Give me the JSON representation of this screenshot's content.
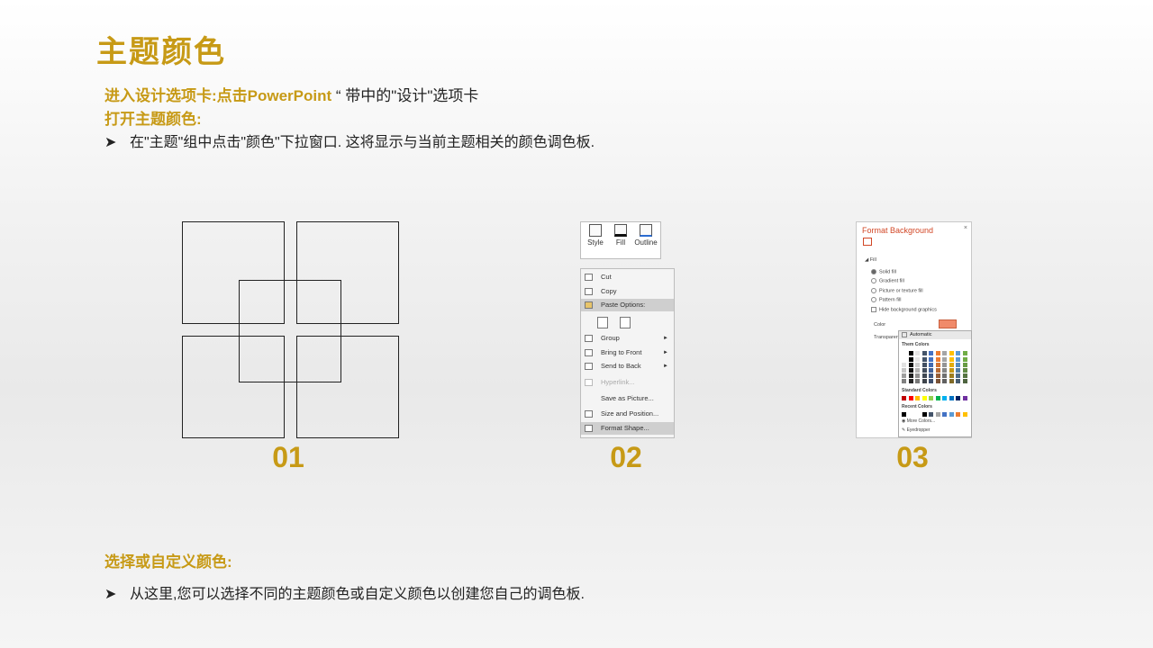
{
  "title": "主题颜色",
  "intro": {
    "line1_bold": "进入设计选项卡:点击PowerPoint",
    "line1_rest": " “ 带中的\"设计\"选项卡",
    "line2": "打开主题颜色:",
    "bullet1": "在\"主题\"组中点击\"颜色\"下拉窗口. 这将显示与当前主题相关的颜色调色板."
  },
  "bullet_char": "➤",
  "steps": [
    "01",
    "02",
    "03"
  ],
  "toolbar": {
    "style": "Style",
    "fill": "Fill",
    "outline": "Outline"
  },
  "context_menu": {
    "items": [
      "Cut",
      "Copy",
      "Paste Options:",
      "Group",
      "Bring to Front",
      "Send to Back",
      "Hyperlink...",
      "Save as Picture...",
      "Size and Position...",
      "Format Shape..."
    ]
  },
  "format_background": {
    "title": "Format Background",
    "close": "×",
    "section": "Fill",
    "options": [
      "Solid fill",
      "Gradient fill",
      "Picture or texture fill",
      "Pattern fill"
    ],
    "hide_bg": "Hide background graphics",
    "color_label": "Color",
    "transparency_label": "Transparency",
    "palette": {
      "automatic": "Automatic",
      "theme_colors": "Them Colors",
      "standard_colors": "Standard Colors",
      "recent_colors": "Recent Colors",
      "more_colors": "More Colors...",
      "eyedropper": "Eyedropper"
    }
  },
  "section2": {
    "heading": "选择或自定义颜色:",
    "bullet": "从这里,您可以选择不同的主题颜色或自定义颜色以创建您自己的调色板."
  },
  "colors": {
    "accent": "#c79a16",
    "text": "#222222"
  }
}
